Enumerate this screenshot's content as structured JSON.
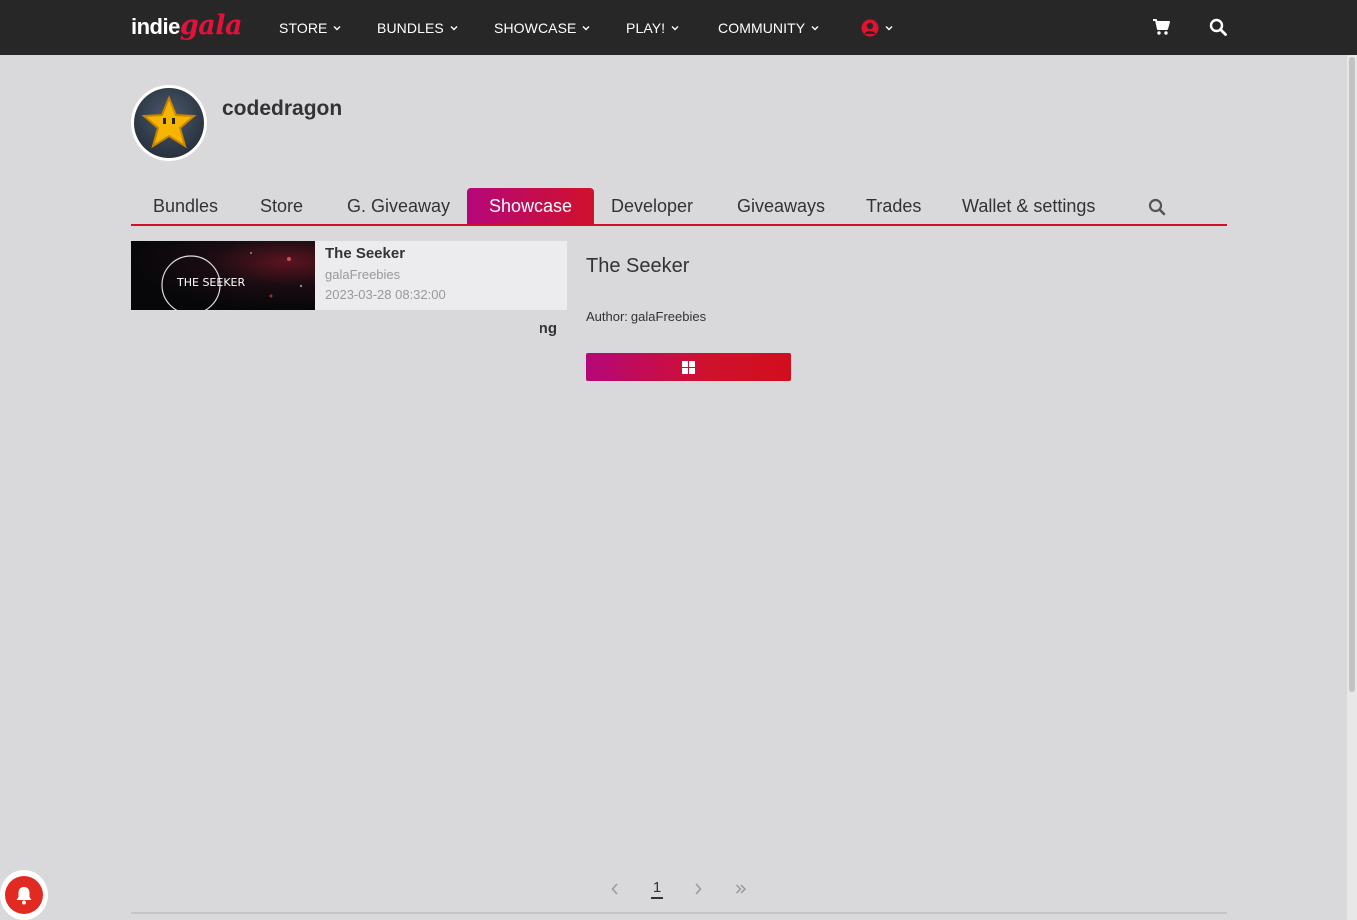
{
  "brand": {
    "part1": "indie",
    "part2": "gala"
  },
  "nav": {
    "items": [
      {
        "label": "STORE"
      },
      {
        "label": "BUNDLES"
      },
      {
        "label": "SHOWCASE"
      },
      {
        "label": "PLAY!"
      },
      {
        "label": "COMMUNITY"
      }
    ],
    "icons": [
      "user-icon",
      "cart-icon",
      "search-icon"
    ]
  },
  "profile": {
    "username": "codedragon"
  },
  "tabs": [
    {
      "label": "Bundles"
    },
    {
      "label": "Store"
    },
    {
      "label": "G. Giveaway"
    },
    {
      "label": "Showcase",
      "active": true
    },
    {
      "label": "Developer"
    },
    {
      "label": "Giveaways"
    },
    {
      "label": "Trades"
    },
    {
      "label": "Wallet & settings"
    }
  ],
  "showcase": {
    "items": [
      {
        "title": "The Seeker",
        "author": "galaFreebies",
        "date": "2023-03-28 08:32:00",
        "thumb_text": "THE SEEKER"
      }
    ],
    "overflow_text": "ng"
  },
  "detail": {
    "title": "The Seeker",
    "author_label": "Author:",
    "author": "galaFreebies",
    "platform_icon": "windows-icon"
  },
  "pagination": {
    "current_page": "1",
    "icons": [
      "prev-icon",
      "next-icon",
      "last-icon"
    ]
  },
  "colors": {
    "accent_red": "#d0112b",
    "accent_magenta": "#b5077a",
    "topbar": "#272727",
    "background": "#d9d8da"
  }
}
